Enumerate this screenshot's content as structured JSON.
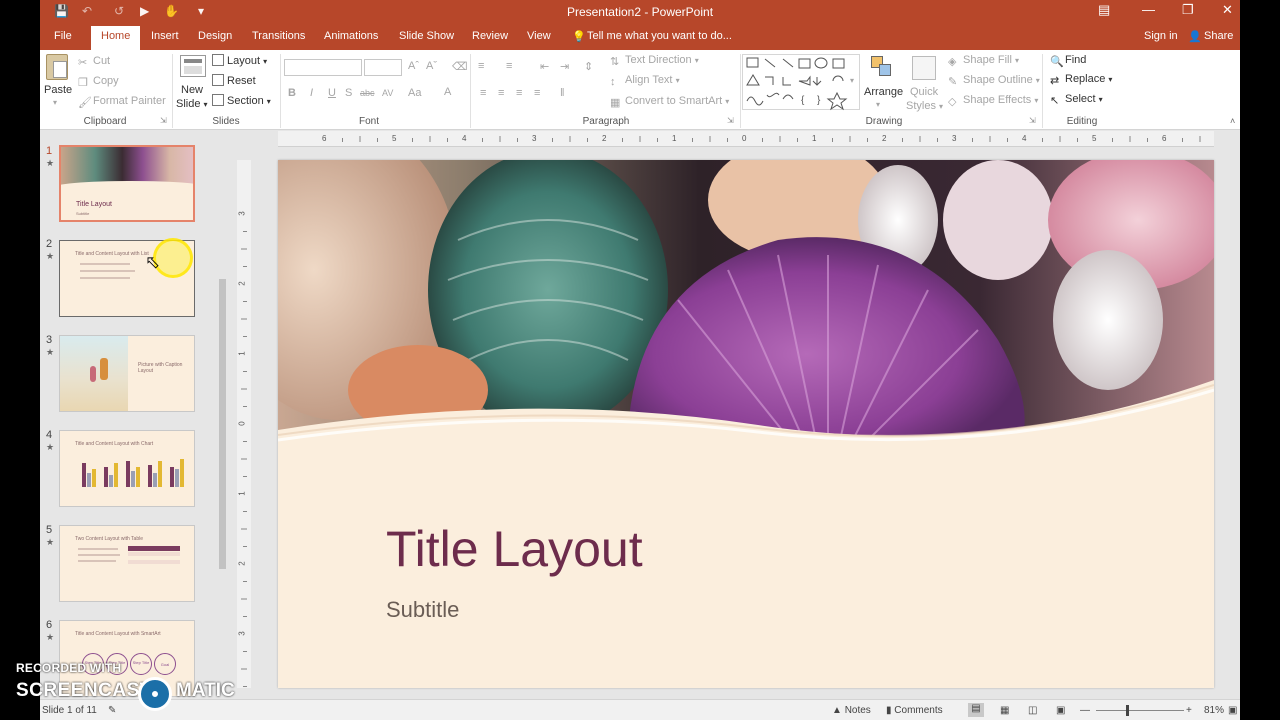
{
  "window": {
    "title": "Presentation2 - PowerPoint"
  },
  "tabs": [
    "File",
    "Home",
    "Insert",
    "Design",
    "Transitions",
    "Animations",
    "Slide Show",
    "Review",
    "View"
  ],
  "tell_me": "Tell me what you want to do...",
  "account": {
    "sign_in": "Sign in",
    "share": "Share"
  },
  "ribbon": {
    "clipboard": {
      "paste": "Paste",
      "cut": "Cut",
      "copy": "Copy",
      "format_painter": "Format Painter",
      "label": "Clipboard"
    },
    "slides": {
      "new_slide_1": "New",
      "new_slide_2": "Slide",
      "layout": "Layout",
      "reset": "Reset",
      "section": "Section",
      "label": "Slides"
    },
    "font": {
      "bold": "B",
      "italic": "I",
      "underline": "U",
      "shadow": "S",
      "strike": "abc",
      "spacing": "AV",
      "case": "Aa",
      "color": "A",
      "label": "Font"
    },
    "paragraph": {
      "text_direction": "Text Direction",
      "align_text": "Align Text",
      "convert_smartart": "Convert to SmartArt",
      "label": "Paragraph"
    },
    "drawing": {
      "arrange": "Arrange",
      "quick_styles_1": "Quick",
      "quick_styles_2": "Styles",
      "shape_fill": "Shape Fill",
      "shape_outline": "Shape Outline",
      "shape_effects": "Shape Effects",
      "label": "Drawing"
    },
    "editing": {
      "find": "Find",
      "replace": "Replace",
      "select": "Select",
      "label": "Editing"
    }
  },
  "ruler": {
    "h": [
      "6",
      "5",
      "4",
      "3",
      "2",
      "1",
      "0",
      "1",
      "2",
      "3",
      "4",
      "5",
      "6"
    ],
    "v": [
      "3",
      "2",
      "1",
      "0",
      "1",
      "2",
      "3"
    ]
  },
  "thumbnails": [
    {
      "num": "1",
      "label": "Title Layout",
      "sub": "Subtitle"
    },
    {
      "num": "2",
      "label": "Title and Content Layout with List"
    },
    {
      "num": "3",
      "label": "Picture with Caption Layout"
    },
    {
      "num": "4",
      "label": "Title and Content Layout with Chart"
    },
    {
      "num": "5",
      "label": "Two Content Layout with Table"
    },
    {
      "num": "6",
      "label": "Title and Content Layout with SmartArt",
      "nodes": [
        "Step Title",
        "Step Title",
        "Step Title",
        "Goal"
      ]
    }
  ],
  "slide": {
    "title": "Title Layout",
    "subtitle": "Subtitle"
  },
  "status": {
    "slide_info": "Slide 1 of 11",
    "notes": "Notes",
    "comments": "Comments",
    "zoom": "81%"
  },
  "watermark": {
    "line1": "RECORDED WITH",
    "line2a": "SCREENCAST",
    "line2b": "MATIC"
  },
  "colors": {
    "accent": "#b7472a",
    "title": "#6d2c4c",
    "slide_bg": "#fbeedd"
  }
}
